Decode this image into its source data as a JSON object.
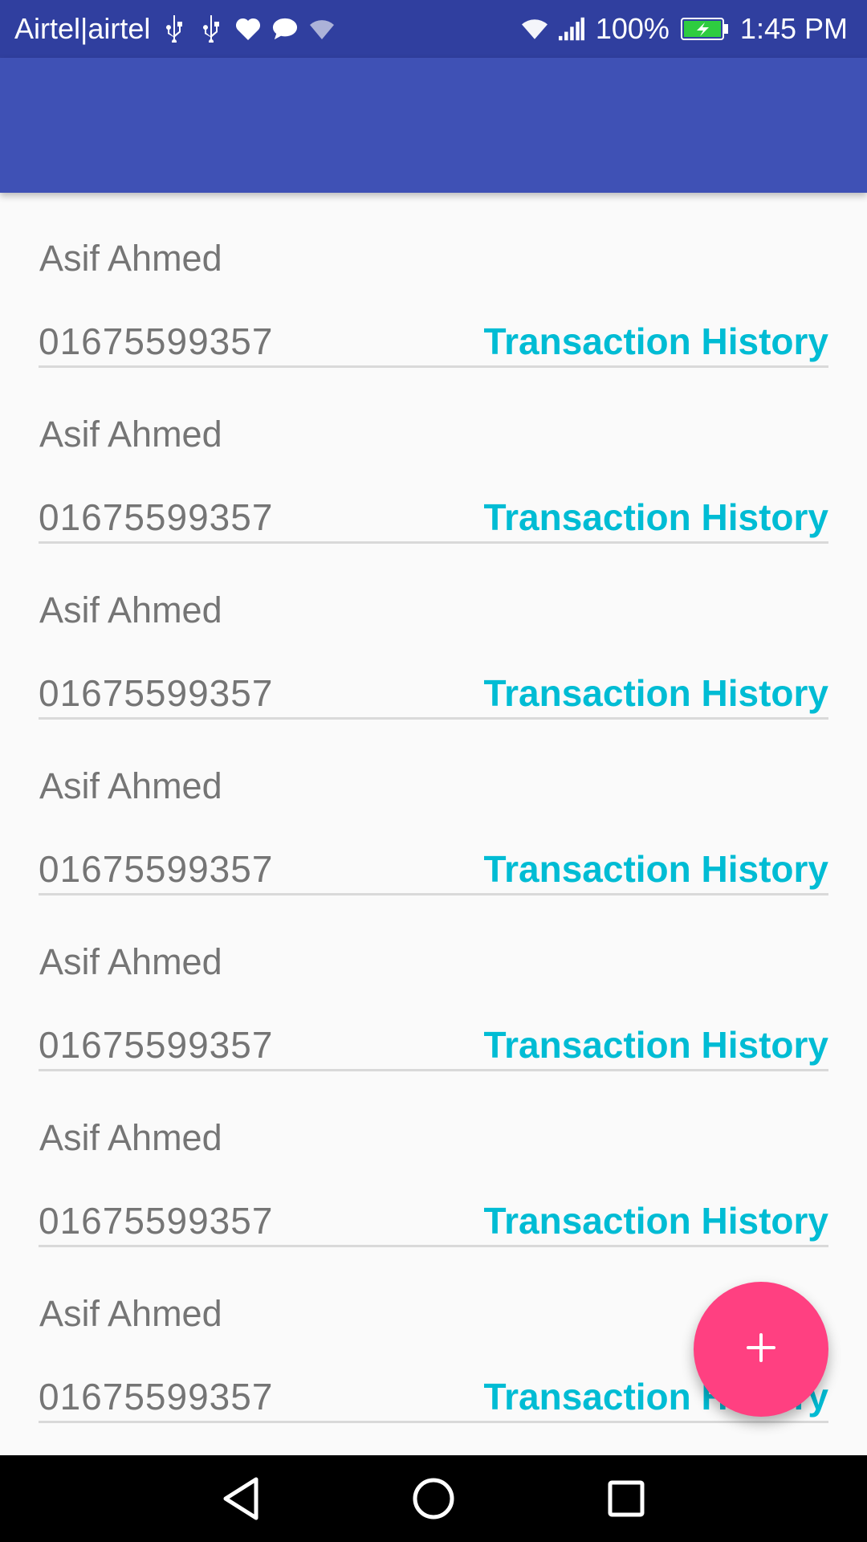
{
  "status_bar": {
    "carrier": "Airtel|airtel",
    "battery_percent": "100%",
    "time": "1:45 PM",
    "icons": [
      "usb-icon",
      "usb-icon",
      "heart-icon",
      "message-icon",
      "wifi-question-icon",
      "wifi-icon",
      "signal-icon",
      "battery-charging-icon"
    ]
  },
  "app_bar": {
    "title": ""
  },
  "list": {
    "items": [
      {
        "name": "Asif Ahmed",
        "phone": "01675599357",
        "link": "Transaction History"
      },
      {
        "name": "Asif Ahmed",
        "phone": "01675599357",
        "link": "Transaction History"
      },
      {
        "name": "Asif Ahmed",
        "phone": "01675599357",
        "link": "Transaction History"
      },
      {
        "name": "Asif Ahmed",
        "phone": "01675599357",
        "link": "Transaction History"
      },
      {
        "name": "Asif Ahmed",
        "phone": "01675599357",
        "link": "Transaction History"
      },
      {
        "name": "Asif Ahmed",
        "phone": "01675599357",
        "link": "Transaction History"
      },
      {
        "name": "Asif Ahmed",
        "phone": "01675599357",
        "link": "Transaction History"
      }
    ]
  },
  "fab": {
    "icon": "plus-icon",
    "color": "#ff4081"
  },
  "nav_bar": {
    "icons": [
      "back-icon",
      "home-icon",
      "recents-icon"
    ]
  },
  "colors": {
    "status_bar": "#303f9f",
    "app_bar": "#3f51b5",
    "link": "#00bcd4",
    "text": "#757575",
    "background": "#fafafa"
  }
}
